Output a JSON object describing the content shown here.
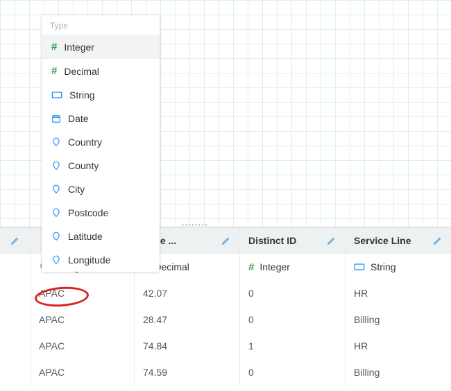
{
  "colors": {
    "green": "#2f9e44",
    "blue": "#1a8cff",
    "pencil": "#4aa3df",
    "ring": "#d72222"
  },
  "dropdown": {
    "header": "Type",
    "items": [
      {
        "label": "Integer",
        "icon": "hash"
      },
      {
        "label": "Decimal",
        "icon": "hash"
      },
      {
        "label": "String",
        "icon": "string"
      },
      {
        "label": "Date",
        "icon": "calendar"
      },
      {
        "label": "Country",
        "icon": "pin"
      },
      {
        "label": "County",
        "icon": "pin"
      },
      {
        "label": "City",
        "icon": "pin"
      },
      {
        "label": "Postcode",
        "icon": "pin"
      },
      {
        "label": "Latitude",
        "icon": "pin"
      },
      {
        "label": "Longitude",
        "icon": "pin"
      }
    ],
    "selected_index": 0
  },
  "table": {
    "columns": [
      {
        "header": "",
        "type_label": "String",
        "type_icon": "pin"
      },
      {
        "header": "enue ...",
        "type_label": "Decimal",
        "type_icon": "hash"
      },
      {
        "header": "Distinct ID",
        "type_label": "Integer",
        "type_icon": "hash"
      },
      {
        "header": "Service Line",
        "type_label": "String",
        "type_icon": "string"
      }
    ],
    "rows": [
      {
        "c0": "APAC",
        "c1": "42.07",
        "c2": "0",
        "c3": "HR"
      },
      {
        "c0": "APAC",
        "c1": "28.47",
        "c2": "0",
        "c3": "Billing"
      },
      {
        "c0": "APAC",
        "c1": "74.84",
        "c2": "1",
        "c3": "HR"
      },
      {
        "c0": "APAC",
        "c1": "74.59",
        "c2": "0",
        "c3": "Billing"
      }
    ]
  }
}
